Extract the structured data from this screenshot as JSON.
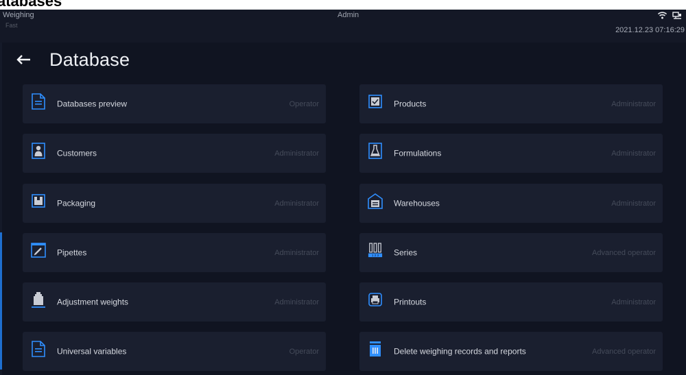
{
  "document": {
    "heading": "atabases"
  },
  "status": {
    "mode": "Weighing",
    "submode": "Fast",
    "user": "Admin",
    "datetime": "2021.12.23 07:16:29"
  },
  "screen": {
    "title": "Database"
  },
  "tiles": [
    {
      "label": "Databases preview",
      "role": "Operator",
      "icon": "document-icon"
    },
    {
      "label": "Products",
      "role": "Administrator",
      "icon": "product-box-icon"
    },
    {
      "label": "Customers",
      "role": "Administrator",
      "icon": "person-icon"
    },
    {
      "label": "Formulations",
      "role": "Administrator",
      "icon": "flask-icon"
    },
    {
      "label": "Packaging",
      "role": "Administrator",
      "icon": "package-icon"
    },
    {
      "label": "Warehouses",
      "role": "Administrator",
      "icon": "warehouse-icon"
    },
    {
      "label": "Pipettes",
      "role": "Administrator",
      "icon": "pipette-icon"
    },
    {
      "label": "Series",
      "role": "Advanced operator",
      "icon": "series-tubes-icon"
    },
    {
      "label": "Adjustment weights",
      "role": "Administrator",
      "icon": "weight-icon"
    },
    {
      "label": "Printouts",
      "role": "Administrator",
      "icon": "printer-icon"
    },
    {
      "label": "Universal variables",
      "role": "Operator",
      "icon": "document-icon"
    },
    {
      "label": "Delete weighing records and reports",
      "role": "Advanced operator",
      "icon": "trash-icon"
    }
  ]
}
